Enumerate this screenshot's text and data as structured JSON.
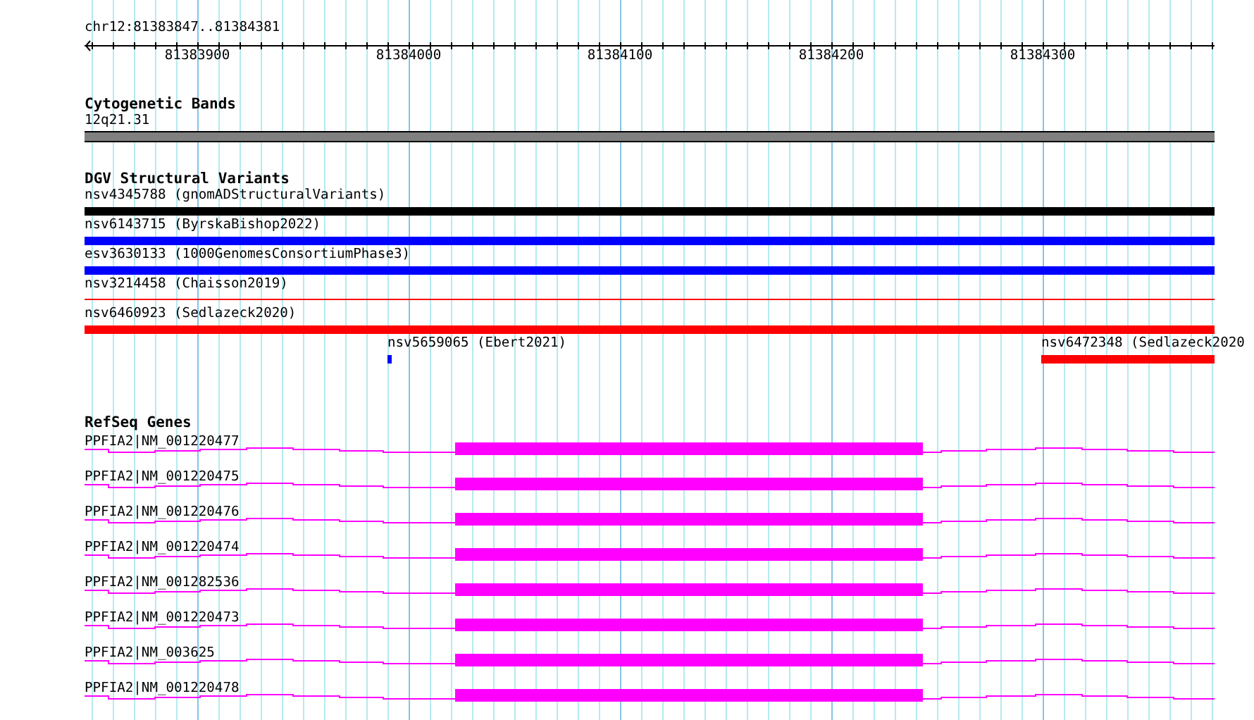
{
  "location": "chr12:81383847..81384381",
  "ruler": {
    "ticks": [
      "81383900",
      "81384000",
      "81384100",
      "81384200",
      "81384300"
    ]
  },
  "tracks": [
    {
      "kind": "cytoband",
      "title": "Cytogenetic Bands",
      "features": [
        {
          "label": "12q21.31",
          "color": "#808080"
        }
      ]
    },
    {
      "kind": "variants",
      "title": "DGV Structural Variants",
      "features": [
        {
          "label": "nsv4345788 (gnomADStructuralVariants)",
          "color": "#000000",
          "kind": "bar"
        },
        {
          "label": "nsv6143715 (ByrskaBishop2022)",
          "color": "#0000ff",
          "kind": "bar"
        },
        {
          "label": "esv3630133 (1000GenomesConsortiumPhase3)",
          "color": "#0000ff",
          "kind": "bar"
        },
        {
          "label": "nsv3214458 (Chaisson2019)",
          "color": "#ff0000",
          "kind": "line"
        },
        {
          "label": "nsv6460923 (Sedlazeck2020)",
          "color": "#ff0000",
          "kind": "bar"
        },
        {
          "label": "nsv5659065 (Ebert2021)",
          "color": "#0000ff",
          "kind": "bar"
        },
        {
          "label": "nsv6472348 (Sedlazeck2020",
          "color": "#ff0000",
          "kind": "bar"
        }
      ]
    },
    {
      "kind": "genes",
      "title": "RefSeq Genes",
      "features": [
        {
          "label": "PPFIA2|NM_001220477",
          "color": "#ff00ff"
        },
        {
          "label": "PPFIA2|NM_001220475",
          "color": "#ff00ff"
        },
        {
          "label": "PPFIA2|NM_001220476",
          "color": "#ff00ff"
        },
        {
          "label": "PPFIA2|NM_001220474",
          "color": "#ff00ff"
        },
        {
          "label": "PPFIA2|NM_001282536",
          "color": "#ff00ff"
        },
        {
          "label": "PPFIA2|NM_001220473",
          "color": "#ff00ff"
        },
        {
          "label": "PPFIA2|NM_003625",
          "color": "#ff00ff"
        },
        {
          "label": "PPFIA2|NM_001220478",
          "color": "#ff00ff"
        }
      ]
    }
  ]
}
